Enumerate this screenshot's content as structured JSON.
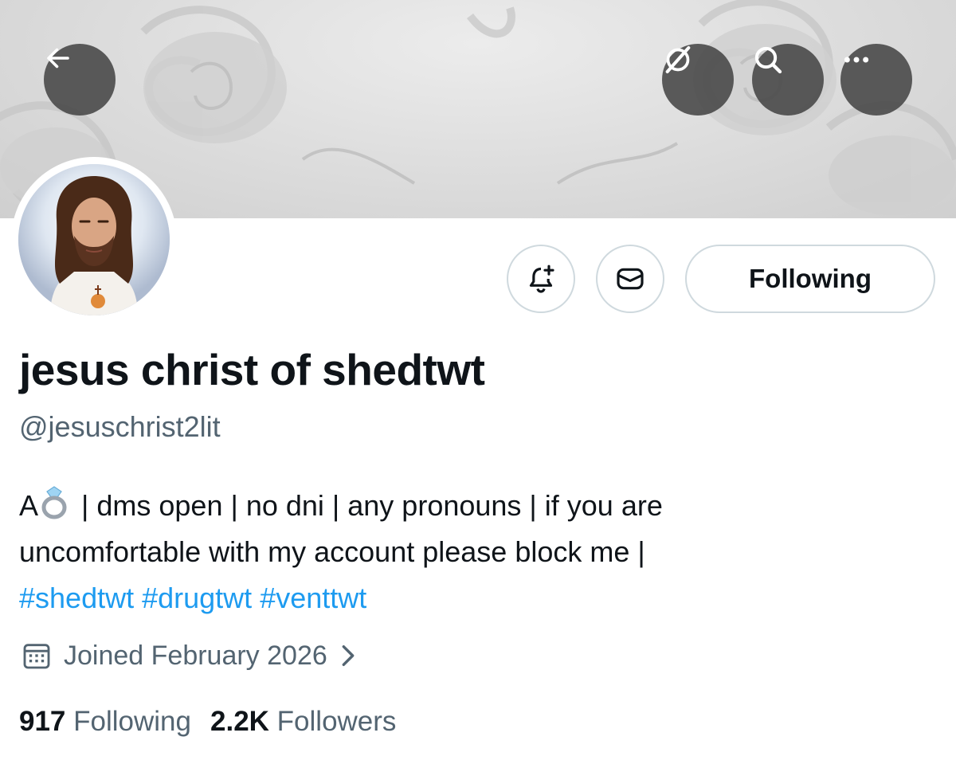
{
  "header": {
    "back_icon": "arrow-left-icon",
    "grok_icon": "grok-icon",
    "search_icon": "search-icon",
    "more_icon": "more-icon"
  },
  "profile": {
    "display_name": "jesus christ of shedtwt",
    "handle": "@jesuschrist2lit",
    "bio": {
      "prefix": "A",
      "emoji": "ring-icon",
      "line1": " | dms open | no dni | any pronouns | if you are",
      "line2": "uncomfortable with my account please block me |",
      "hashtags": [
        "#shedtwt",
        "#drugtwt",
        "#venttwt"
      ]
    },
    "joined": "Joined February 2026",
    "following_count": "917",
    "following_label": "Following",
    "followers_count": "2.2K",
    "followers_label": "Followers"
  },
  "actions": {
    "notify_icon": "bell-plus-icon",
    "message_icon": "envelope-icon",
    "follow_state_label": "Following"
  },
  "colors": {
    "link": "#1d9bf0",
    "secondary_text": "#536471",
    "primary_text": "#0f1419",
    "button_border": "#cfd9de"
  }
}
